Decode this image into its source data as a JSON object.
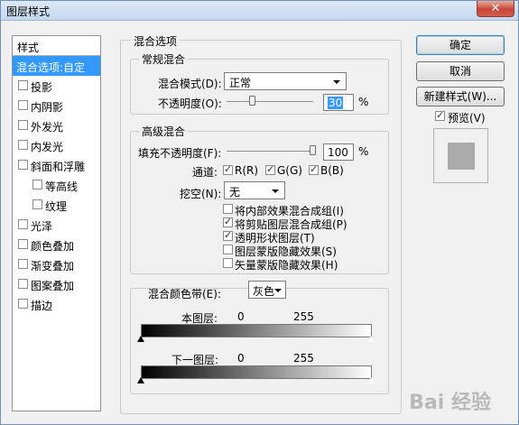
{
  "window": {
    "title": "图层样式",
    "close": "✕"
  },
  "left_list": {
    "header": "样式",
    "items": [
      {
        "label": "混合选项:自定",
        "selected": true,
        "checkbox": false
      },
      {
        "label": "投影",
        "checked": false,
        "checkbox": true
      },
      {
        "label": "内阴影",
        "checked": false,
        "checkbox": true
      },
      {
        "label": "外发光",
        "checked": false,
        "checkbox": true
      },
      {
        "label": "内发光",
        "checked": false,
        "checkbox": true
      },
      {
        "label": "斜面和浮雕",
        "checked": false,
        "checkbox": true
      },
      {
        "label": "等高线",
        "checked": false,
        "checkbox": true,
        "sub": true
      },
      {
        "label": "纹理",
        "checked": false,
        "checkbox": true,
        "sub": true
      },
      {
        "label": "光泽",
        "checked": false,
        "checkbox": true
      },
      {
        "label": "颜色叠加",
        "checked": false,
        "checkbox": true
      },
      {
        "label": "渐变叠加",
        "checked": false,
        "checkbox": true
      },
      {
        "label": "图案叠加",
        "checked": false,
        "checkbox": true
      },
      {
        "label": "描边",
        "checked": false,
        "checkbox": true
      }
    ]
  },
  "blend_options": {
    "title": "混合选项",
    "general": {
      "title": "常规混合",
      "mode_label": "混合模式(D):",
      "mode_value": "正常",
      "opacity_label": "不透明度(O):",
      "opacity_value": "30",
      "opacity_unit": "%",
      "opacity_fraction": 0.3
    },
    "advanced": {
      "title": "高级混合",
      "fill_label": "填充不透明度(F):",
      "fill_value": "100",
      "fill_unit": "%",
      "channels_label": "通道:",
      "channels": [
        {
          "label": "R(R)",
          "checked": true
        },
        {
          "label": "G(G)",
          "checked": true
        },
        {
          "label": "B(B)",
          "checked": true
        }
      ],
      "knockout_label": "挖空(N):",
      "knockout_value": "无",
      "options": [
        {
          "label": "将内部效果混合成组(I)",
          "checked": false
        },
        {
          "label": "将剪贴图层混合成组(P)",
          "checked": true
        },
        {
          "label": "透明形状图层(T)",
          "checked": true
        },
        {
          "label": "图层蒙版隐藏效果(S)",
          "checked": false
        },
        {
          "label": "矢量蒙版隐藏效果(H)",
          "checked": false
        }
      ]
    },
    "blend_if": {
      "label": "混合颜色带(E):",
      "value": "灰色",
      "this_layer_label": "本图层:",
      "this_layer_low": "0",
      "this_layer_high": "255",
      "under_layer_label": "下一图层:",
      "under_layer_low": "0",
      "under_layer_high": "255"
    }
  },
  "buttons": {
    "ok": "确定",
    "cancel": "取消",
    "new_style": "新建样式(W)...",
    "preview_label": "预览(V)",
    "preview_checked": true
  },
  "watermark": "Bai 经验"
}
